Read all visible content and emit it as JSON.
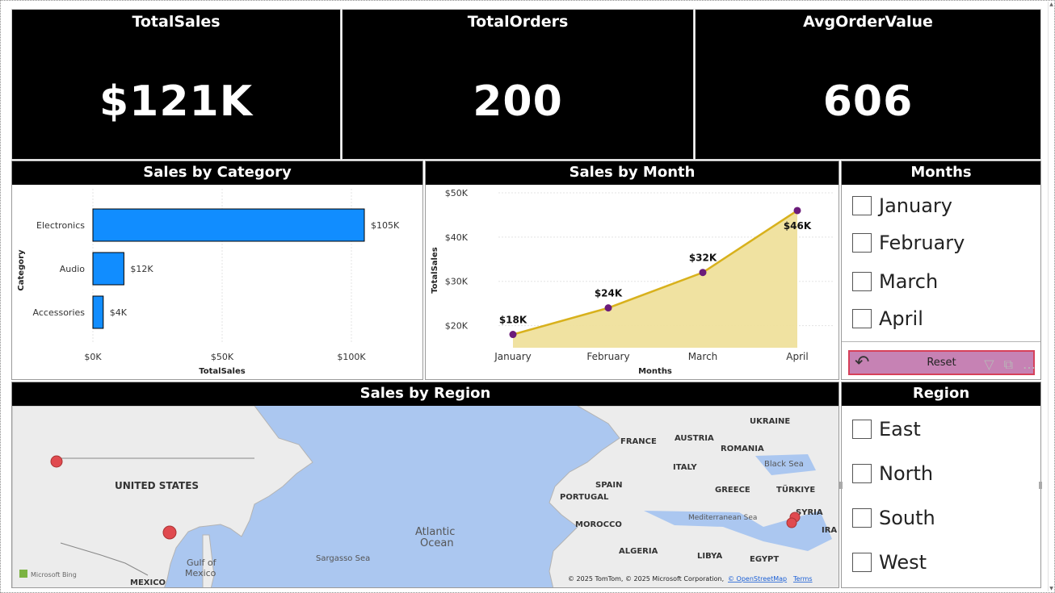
{
  "kpis": [
    {
      "title": "TotalSales",
      "value": "$121K"
    },
    {
      "title": "TotalOrders",
      "value": "200"
    },
    {
      "title": "AvgOrderValue",
      "value": "606"
    }
  ],
  "sales_by_category": {
    "title": "Sales by Category",
    "xlabel": "TotalSales",
    "ylabel": "Category",
    "categories": [
      "Electronics",
      "Audio",
      "Accessories"
    ],
    "values": [
      105,
      12,
      4
    ],
    "data_labels": [
      "$105K",
      "$12K",
      "$4K"
    ],
    "x_ticks": [
      "$0K",
      "$50K",
      "$100K"
    ],
    "x_tick_values": [
      0,
      50,
      100
    ],
    "xlim": [
      0,
      105
    ],
    "bar_color": "#118dff"
  },
  "sales_by_month": {
    "title": "Sales by Month",
    "xlabel": "Months",
    "ylabel": "TotalSales",
    "months": [
      "January",
      "February",
      "March",
      "April"
    ],
    "values": [
      18,
      24,
      32,
      46
    ],
    "data_labels": [
      "$18K",
      "$24K",
      "$32K",
      "$46K"
    ],
    "y_ticks": [
      "$20K",
      "$30K",
      "$40K",
      "$50K"
    ],
    "y_tick_values": [
      20,
      30,
      40,
      50
    ],
    "ylim": [
      15,
      50
    ],
    "line_color": "#d8b11c",
    "area_color": "#efe09c",
    "marker_color": "#6b1b7a"
  },
  "months_slicer": {
    "title": "Months",
    "items": [
      "January",
      "February",
      "March",
      "April"
    ],
    "reset_label": "Reset"
  },
  "region_slicer": {
    "title": "Region",
    "items": [
      "East",
      "North",
      "South",
      "West"
    ]
  },
  "sales_by_region": {
    "title": "Sales by Region",
    "labels": {
      "united_states": "UNITED STATES",
      "mexico": "MEXICO",
      "gulf": "Gulf of",
      "gulf2": "Mexico",
      "atlantic": "Atlantic",
      "ocean": "Ocean",
      "sargasso": "Sargasso Sea",
      "france": "FRANCE",
      "ukraine": "UKRAINE",
      "austria": "AUSTRIA",
      "romania": "ROMANIA",
      "black_sea": "Black Sea",
      "italy": "ITALY",
      "spain": "SPAIN",
      "portugal": "PORTUGAL",
      "greece": "GREECE",
      "turkiye": "TÜRKIYE",
      "mediterranean": "Mediterranean Sea",
      "syria": "SYRIA",
      "ira": "IRA",
      "morocco": "MOROCCO",
      "algeria": "ALGERIA",
      "libya": "LIBYA",
      "egypt": "EGYPT"
    },
    "bing_logo": "Microsoft Bing",
    "attribution": "© 2025 TomTom, © 2025 Microsoft Corporation,",
    "osm_link": "© OpenStreetMap",
    "terms_link": "Terms",
    "bubble_color": "#e04a4f",
    "water_color": "#abc7f0",
    "land_color": "#ececec"
  }
}
